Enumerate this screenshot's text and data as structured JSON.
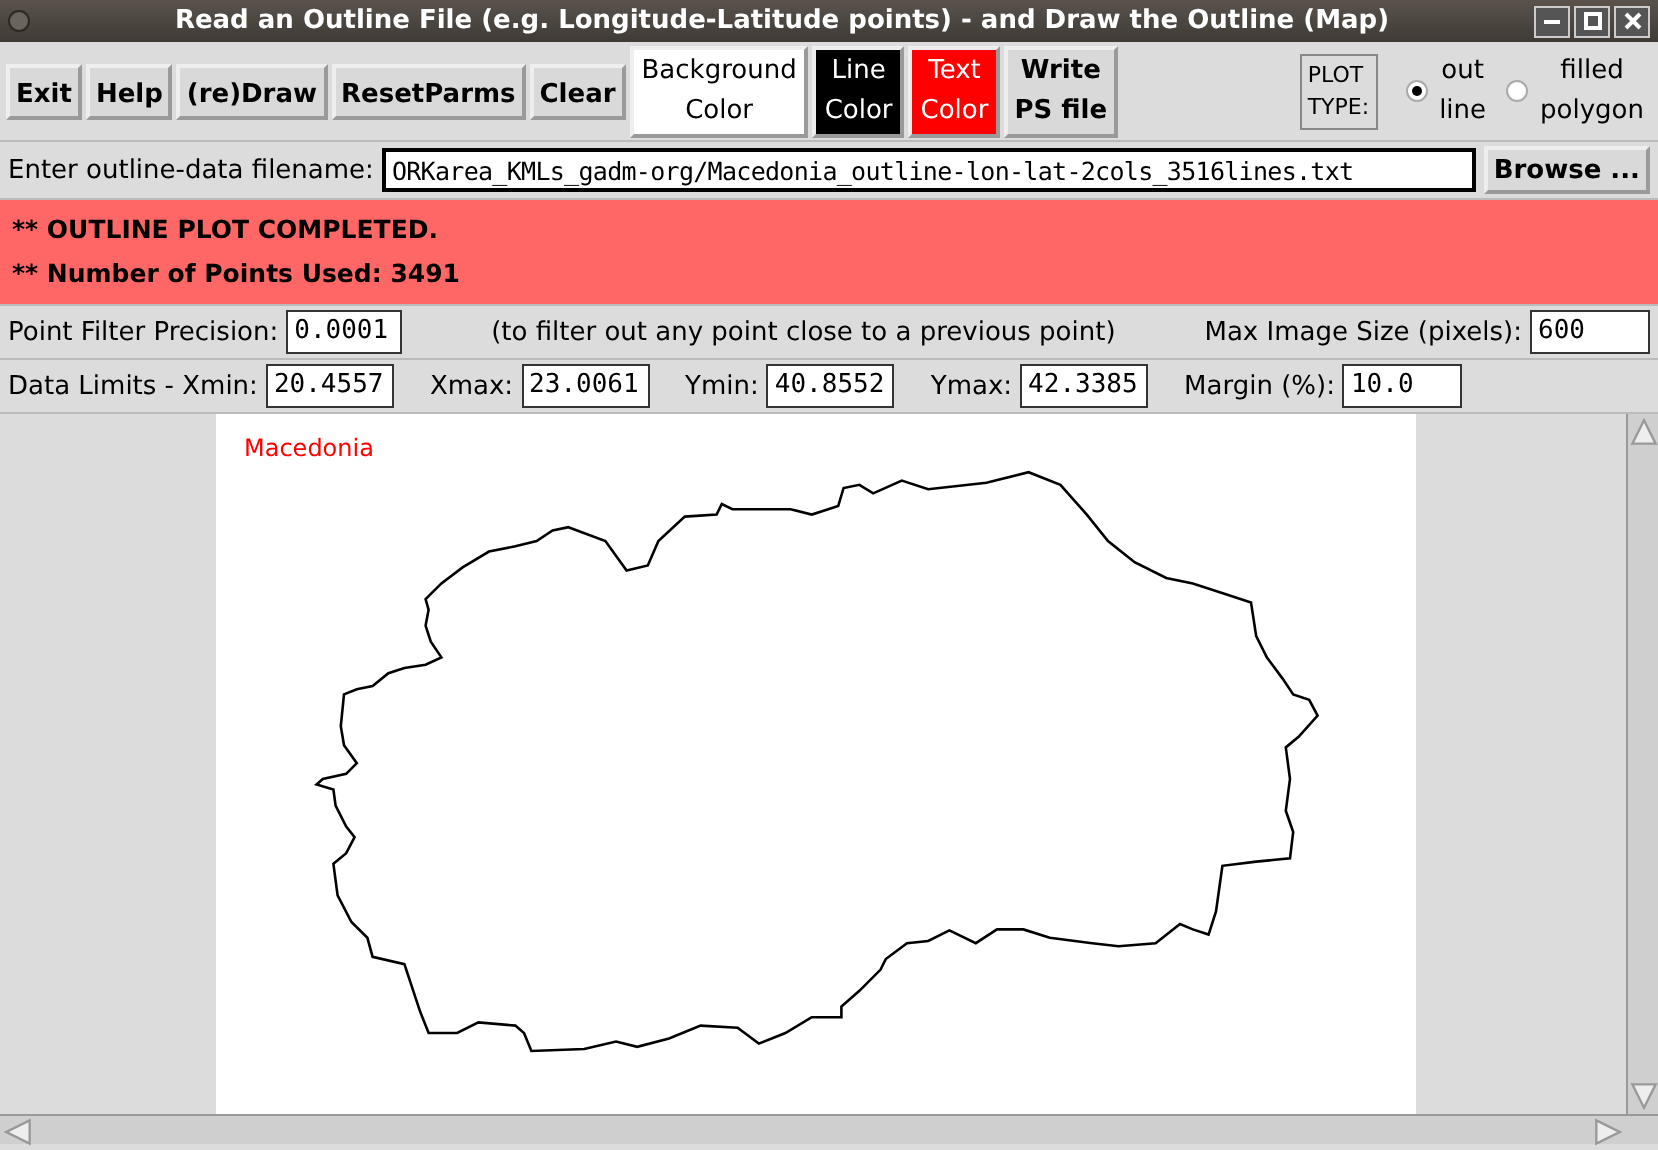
{
  "window": {
    "title": "Read an Outline File (e.g. Longitude-Latitude points) - and Draw the Outline (Map)"
  },
  "toolbar": {
    "buttons": [
      "Exit",
      "Help",
      "(re)Draw",
      "ResetParms",
      "Clear"
    ],
    "color_buttons": [
      {
        "label": "Background\nColor",
        "color": "#ffffff"
      },
      {
        "label": "Line\nColor",
        "color": "#000000"
      },
      {
        "label": "Text\nColor",
        "color": "#ff0000"
      }
    ],
    "write_button": "Write\nPS file",
    "plot_type": {
      "label": "PLOT\nTYPE:",
      "options": [
        {
          "label": "out\nline",
          "selected": true
        },
        {
          "label": "filled\npolygon",
          "selected": false
        }
      ]
    }
  },
  "file": {
    "label": "Enter outline-data filename:",
    "value": "ORKarea_KMLs_gadm-org/Macedonia_outline-lon-lat-2cols_3516lines.txt",
    "browse": "Browse ..."
  },
  "status": [
    "** OUTLINE PLOT COMPLETED.",
    "** Number of Points Used: 3491"
  ],
  "filter": {
    "label": "Point Filter Precision:",
    "value": "0.0001",
    "note": "(to filter out any point close to a previous point)",
    "size_label": "Max Image Size (pixels):",
    "size_value": "600"
  },
  "limits": [
    {
      "label": "Data Limits - Xmin:",
      "value": "20.4557"
    },
    {
      "label": "Xmax:",
      "value": "23.0061"
    },
    {
      "label": "Ymin:",
      "value": "40.8552"
    },
    {
      "label": "Ymax:",
      "value": "42.3385"
    },
    {
      "label": "Margin (%):",
      "value": "10.0"
    }
  ],
  "canvas": {
    "map_title": "Macedonia"
  }
}
